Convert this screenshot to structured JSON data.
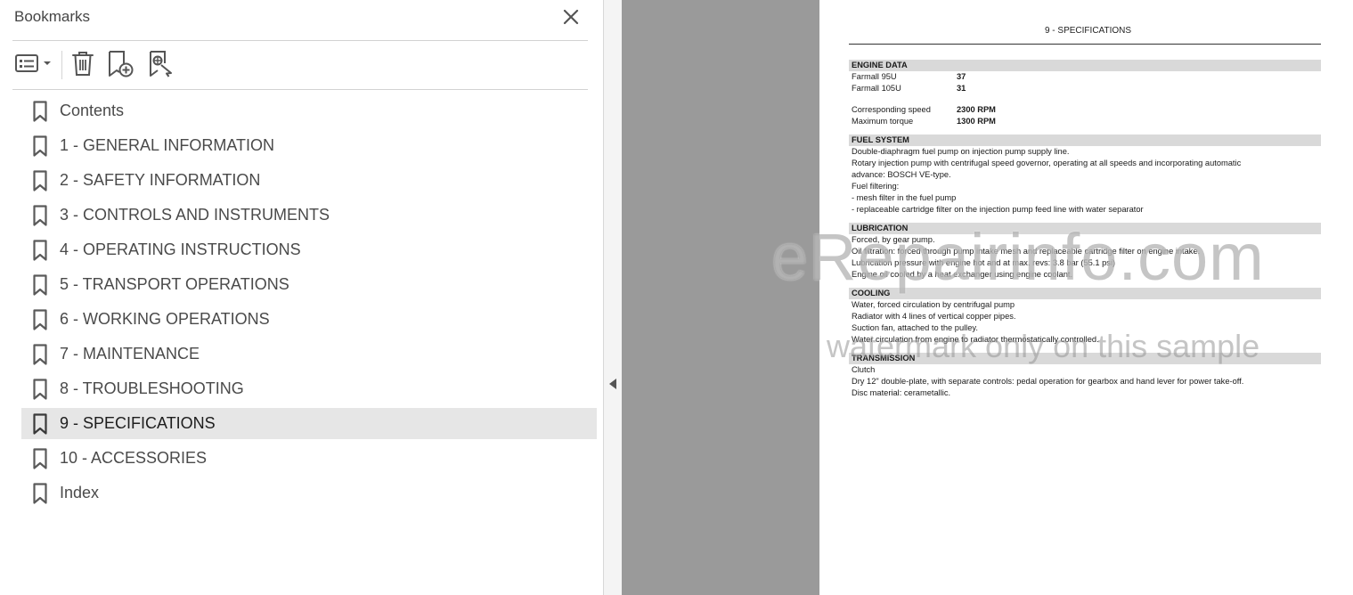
{
  "panel": {
    "title": "Bookmarks",
    "close_icon": "close-icon",
    "toolbar": [
      {
        "name": "options-menu",
        "icon": "list-options-icon"
      },
      {
        "name": "delete-bookmark",
        "icon": "trash-icon"
      },
      {
        "name": "new-bookmark",
        "icon": "add-bookmark-icon"
      },
      {
        "name": "find-bookmark",
        "icon": "find-bookmark-icon"
      }
    ],
    "items": [
      {
        "label": "Contents"
      },
      {
        "label": "1 - GENERAL INFORMATION"
      },
      {
        "label": "2 - SAFETY INFORMATION"
      },
      {
        "label": "3 - CONTROLS AND INSTRUMENTS"
      },
      {
        "label": "4 - OPERATING INSTRUCTIONS"
      },
      {
        "label": "5 - TRANSPORT OPERATIONS"
      },
      {
        "label": "6 - WORKING OPERATIONS"
      },
      {
        "label": "7 - MAINTENANCE"
      },
      {
        "label": "8 - TROUBLESHOOTING"
      },
      {
        "label": "9 - SPECIFICATIONS",
        "selected": true
      },
      {
        "label": "10 - ACCESSORIES"
      },
      {
        "label": "Index"
      }
    ]
  },
  "document": {
    "header": "9 - SPECIFICATIONS",
    "engine": {
      "title": "ENGINE DATA",
      "rows1": [
        {
          "k": "Farmall 95U",
          "v": "37"
        },
        {
          "k": "Farmall 105U",
          "v": "31"
        }
      ],
      "rows2": [
        {
          "k": "Corresponding speed",
          "v": "2300 RPM"
        },
        {
          "k": "Maximum torque",
          "v": "1300 RPM"
        }
      ]
    },
    "fuel": {
      "title": "FUEL SYSTEM",
      "lines": [
        "Double-diaphragm fuel pump on injection pump supply line.",
        "Rotary injection pump with centrifugal speed governor, operating at all speeds and incorporating automatic",
        "advance:  BOSCH VE-type.",
        "Fuel filtering:",
        "- mesh filter in the fuel pump",
        "- replaceable cartridge filter on the injection pump feed line with water separator"
      ]
    },
    "lubrication": {
      "title": "LUBRICATION",
      "lines": [
        "Forced, by gear pump.",
        "Oil filtration:  forced through pump intake mesh and replaceable cartridge filter on engine intake.",
        "Lubrication pressure with engine hot and at max. revs: 3.8 bar (55.1 psi)",
        "Engine oil cooled by a heat exchanger using engine coolant."
      ]
    },
    "cooling": {
      "title": "COOLING",
      "lines": [
        "Water, forced circulation by centrifugal pump",
        "Radiator with 4 lines of vertical copper pipes.",
        "Suction fan, attached to the pulley.",
        "Water circulation from engine to radiator thermostatically controlled."
      ]
    },
    "transmission": {
      "title": "TRANSMISSION",
      "lines": [
        "Clutch",
        "Dry 12\" double-plate, with separate controls:  pedal operation for gearbox and hand lever for power take-off.",
        "Disc material:  cerametallic."
      ]
    },
    "watermark": "eRepairinfo.com",
    "watermark_note": "watermark only on this sample"
  },
  "colors": {
    "selected_bg": "#e6e6e6",
    "gray_area": "#9a9a9a",
    "section_bg": "#d9d9d9"
  }
}
